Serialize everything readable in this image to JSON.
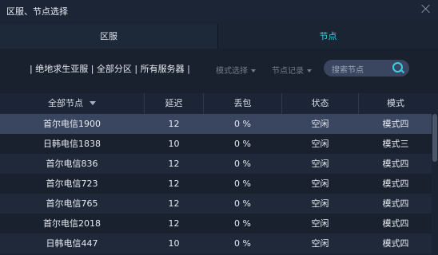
{
  "window": {
    "title": "区服、节点选择"
  },
  "tabs": [
    {
      "label": "区服",
      "active": false
    },
    {
      "label": "节点",
      "active": true
    }
  ],
  "filters": {
    "servers_text": "| 绝地求生亚服 | 全部分区 | 所有服务器 |",
    "mode_select": "模式选择",
    "node_history": "节点记录",
    "search_placeholder": "搜索节点"
  },
  "table": {
    "columns": [
      "全部节点",
      "延迟",
      "丢包",
      "状态",
      "模式"
    ],
    "rows": [
      {
        "node": "首尔电信1900",
        "latency": "12",
        "loss": "0 %",
        "status": "空闲",
        "mode": "模式四",
        "selected": true
      },
      {
        "node": "日韩电信1838",
        "latency": "10",
        "loss": "0 %",
        "status": "空闲",
        "mode": "模式三"
      },
      {
        "node": "首尔电信836",
        "latency": "12",
        "loss": "0 %",
        "status": "空闲",
        "mode": "模式四"
      },
      {
        "node": "首尔电信723",
        "latency": "12",
        "loss": "0 %",
        "status": "空闲",
        "mode": "模式四"
      },
      {
        "node": "首尔电信765",
        "latency": "12",
        "loss": "0 %",
        "status": "空闲",
        "mode": "模式四"
      },
      {
        "node": "首尔电信2018",
        "latency": "12",
        "loss": "0 %",
        "status": "空闲",
        "mode": "模式四"
      },
      {
        "node": "日韩电信447",
        "latency": "10",
        "loss": "0 %",
        "status": "空闲",
        "mode": "模式四"
      }
    ]
  },
  "colors": {
    "accent": "#37d7e8",
    "background": "#1a2433",
    "row_selected": "#3a4660",
    "row_alt_a": "#1f2939",
    "row_alt_b": "#19212e"
  }
}
